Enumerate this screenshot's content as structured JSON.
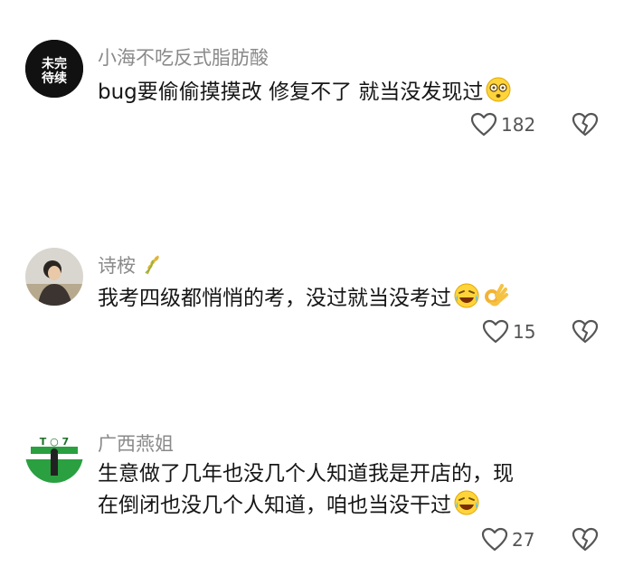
{
  "comments": [
    {
      "username": "小海不吃反式脂肪酸",
      "avatar_text": [
        "未完",
        "待续"
      ],
      "text": "bug要偷偷摸摸改 修复不了 就当没发现过",
      "emoji": [
        "dizzy-face-emoji"
      ],
      "likes": "182"
    },
    {
      "username": "诗桉",
      "username_badge": "wheat-icon",
      "text": "我考四级都悄悄的考，没过就当没考过",
      "emoji": [
        "rofl-emoji",
        "ok-hand-emoji"
      ],
      "likes": "15"
    },
    {
      "username": "广西燕姐",
      "text_lines": [
        "生意做了几年也没几个人知道我是开店的，现",
        "在倒闭也没几个人知道，咱也当没干过"
      ],
      "emoji": [
        "rofl-emoji"
      ],
      "likes": "27"
    }
  ],
  "colors": {
    "username": "#8a8a8a",
    "text": "#161616",
    "icon": "#555555",
    "avatar1_bg": "#111111",
    "avatar3_bg": "#2aa040"
  }
}
